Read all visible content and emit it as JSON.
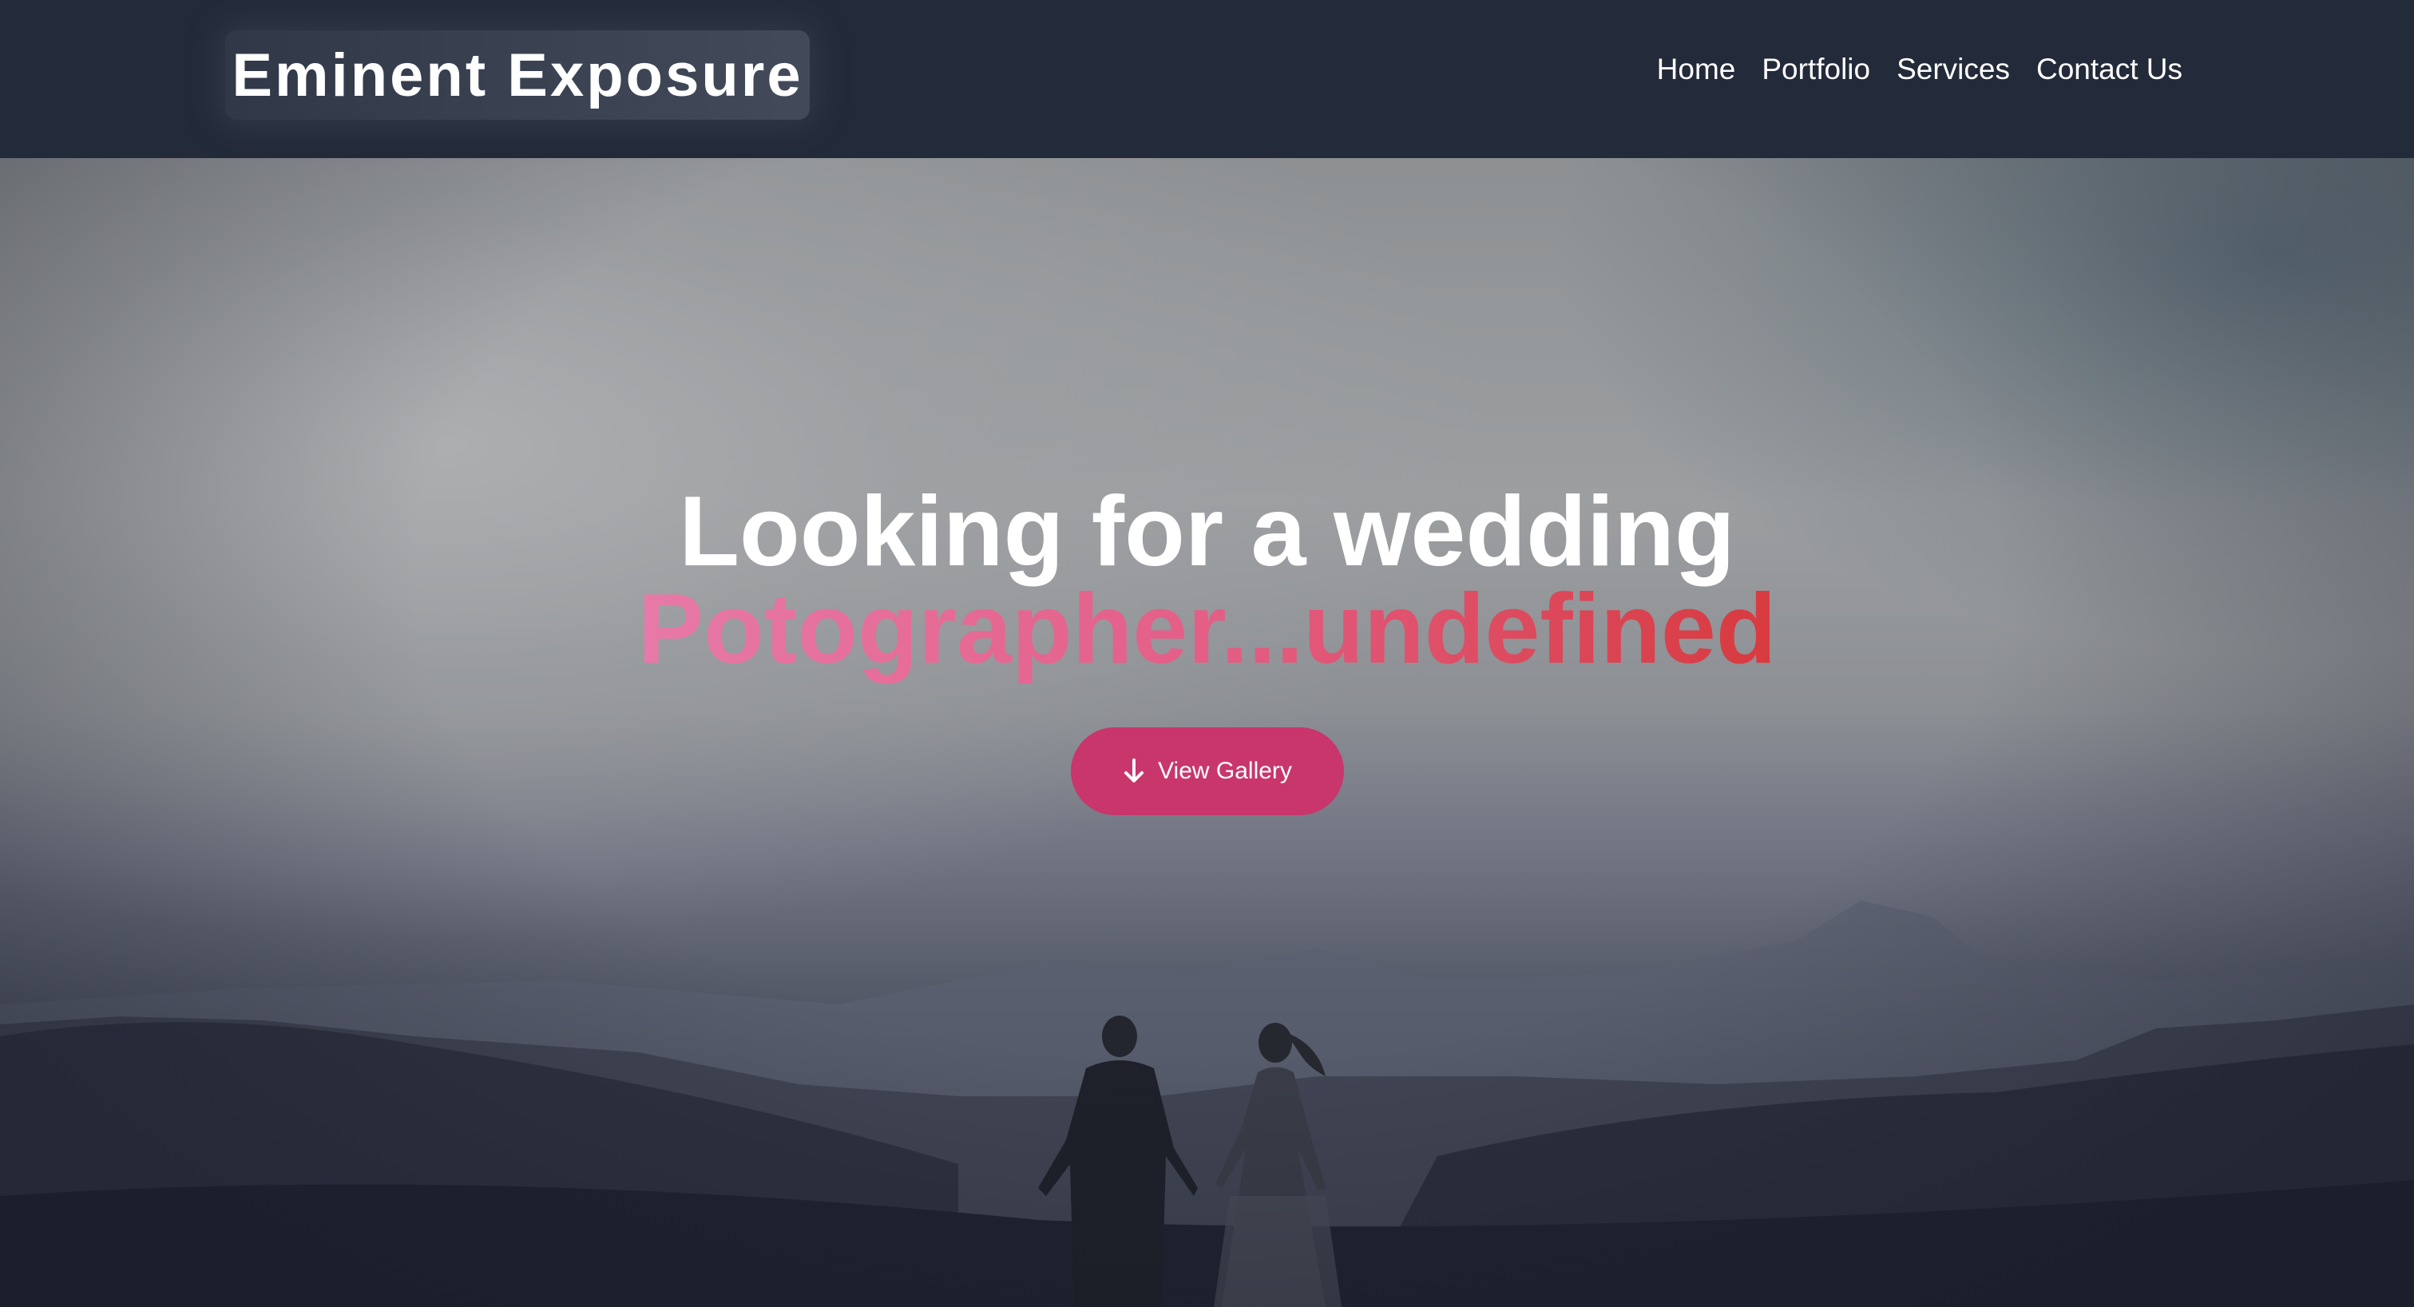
{
  "header": {
    "brand": "Eminent Exposure",
    "nav": [
      {
        "label": "Home"
      },
      {
        "label": "Portfolio"
      },
      {
        "label": "Services"
      },
      {
        "label": "Contact Us"
      }
    ]
  },
  "hero": {
    "title": "Looking for a wedding",
    "subtitle": "Potographer...undefined",
    "cta_label": "View Gallery",
    "cta_icon": "arrow-down-icon",
    "background_image": "couple-silhouette-on-hills-photo"
  },
  "colors": {
    "header_bg": "#232a39",
    "accent": "#c8366c",
    "subtitle_gradient_start": "#e77aa8",
    "subtitle_gradient_end": "#d73a3e"
  }
}
